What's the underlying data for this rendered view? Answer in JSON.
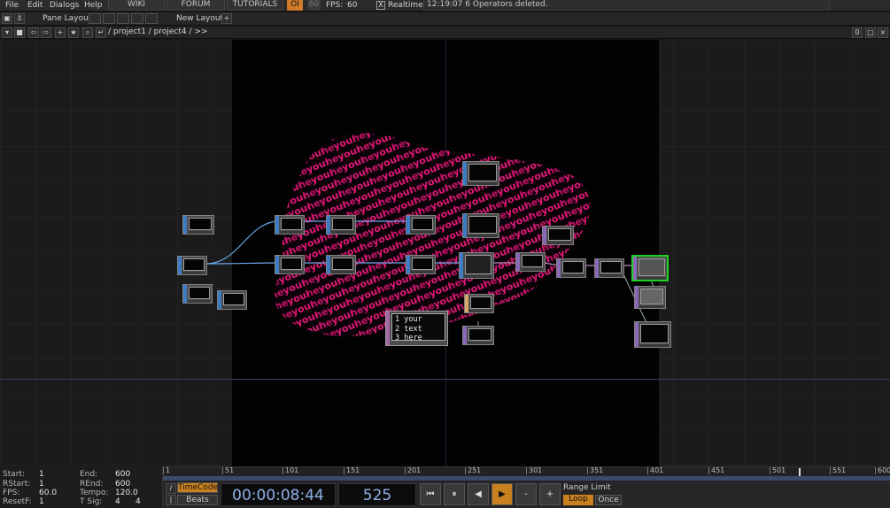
{
  "menu": {
    "items": [
      "File",
      "Edit",
      "Dialogs",
      "Help"
    ],
    "links": [
      "WIKI",
      "FORUM",
      "TUTORIALS"
    ],
    "oi": "OI",
    "fps_cap": "60",
    "fps_label": "FPS:",
    "fps_value": "60",
    "realtime_check": "X",
    "realtime_label": "Realtime",
    "status": "12:19:07 6 Operators deleted."
  },
  "panebar": {
    "pane_layout": "Pane Layout",
    "new_layout": "New Layout",
    "add": "+"
  },
  "pathbar": {
    "path": "/ project1 / project4 / >>",
    "right_value": "0"
  },
  "text_dat": {
    "lines": [
      "1 your",
      "2 text",
      "3 here"
    ]
  },
  "timeline": {
    "ticks": [
      "1",
      "51",
      "101",
      "151",
      "201",
      "251",
      "301",
      "351",
      "401",
      "451",
      "501",
      "551",
      "600"
    ]
  },
  "info": {
    "start_label": "Start:",
    "start": "1",
    "end_label": "End:",
    "end": "600",
    "rstart_label": "RStart:",
    "rstart": "1",
    "rend_label": "REnd:",
    "rend": "600",
    "fps_label": "FPS:",
    "fps": "60.0",
    "tempo_label": "Tempo:",
    "tempo": "120.0",
    "resetf_label": "ResetF:",
    "resetf": "1",
    "tsig_label": "T Sig:",
    "tsig_a": "4",
    "tsig_b": "4"
  },
  "transport": {
    "timecode": "TimeCode",
    "beats": "Beats",
    "time": "00:00:08:44",
    "frame": "525",
    "rewind": "⏮",
    "pause": "⏸",
    "back": "◀",
    "play": "▶",
    "minus": "-",
    "plus": "+",
    "range_limit": "Range Limit",
    "loop": "Loop",
    "once": "Once"
  },
  "colors": {
    "accent_orange": "#c9801f",
    "selected_green": "#1ed31e",
    "text_pink": "#e8187a"
  }
}
